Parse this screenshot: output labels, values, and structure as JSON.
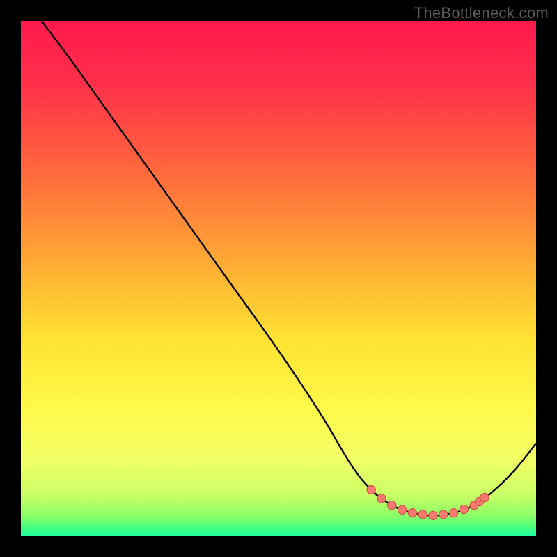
{
  "watermark": "TheBottleneck.com",
  "chart_data": {
    "type": "line",
    "title": "",
    "xlabel": "",
    "ylabel": "",
    "xlim": [
      0,
      100
    ],
    "ylim": [
      0,
      100
    ],
    "grid": false,
    "curve": [
      {
        "x": 4,
        "y": 100
      },
      {
        "x": 10,
        "y": 92
      },
      {
        "x": 20,
        "y": 78
      },
      {
        "x": 30,
        "y": 64
      },
      {
        "x": 40,
        "y": 50
      },
      {
        "x": 50,
        "y": 36
      },
      {
        "x": 58,
        "y": 24
      },
      {
        "x": 64,
        "y": 14
      },
      {
        "x": 68,
        "y": 9
      },
      {
        "x": 72,
        "y": 6
      },
      {
        "x": 76,
        "y": 4.5
      },
      {
        "x": 80,
        "y": 4
      },
      {
        "x": 84,
        "y": 4.5
      },
      {
        "x": 88,
        "y": 6
      },
      {
        "x": 92,
        "y": 9
      },
      {
        "x": 96,
        "y": 13
      },
      {
        "x": 100,
        "y": 18
      }
    ],
    "optimum_points": [
      {
        "x": 68,
        "y": 9
      },
      {
        "x": 70,
        "y": 7.3
      },
      {
        "x": 72,
        "y": 6
      },
      {
        "x": 74,
        "y": 5.1
      },
      {
        "x": 76,
        "y": 4.5
      },
      {
        "x": 78,
        "y": 4.2
      },
      {
        "x": 80,
        "y": 4
      },
      {
        "x": 82,
        "y": 4.2
      },
      {
        "x": 84,
        "y": 4.5
      },
      {
        "x": 86,
        "y": 5.2
      },
      {
        "x": 88,
        "y": 6
      },
      {
        "x": 89,
        "y": 6.7
      },
      {
        "x": 90,
        "y": 7.5
      }
    ],
    "gradient_stops": [
      {
        "offset": 0.0,
        "color": "#ff1a4d"
      },
      {
        "offset": 0.12,
        "color": "#ff2f4a"
      },
      {
        "offset": 0.25,
        "color": "#ff5a3f"
      },
      {
        "offset": 0.38,
        "color": "#ff8838"
      },
      {
        "offset": 0.5,
        "color": "#ffb733"
      },
      {
        "offset": 0.62,
        "color": "#ffe333"
      },
      {
        "offset": 0.75,
        "color": "#fff94a"
      },
      {
        "offset": 0.85,
        "color": "#f3ff66"
      },
      {
        "offset": 0.92,
        "color": "#c9ff66"
      },
      {
        "offset": 0.96,
        "color": "#8dff66"
      },
      {
        "offset": 0.985,
        "color": "#3fff80"
      },
      {
        "offset": 1.0,
        "color": "#1fffa3"
      }
    ],
    "point_fill": "#fb7a6f",
    "point_stroke": "#c94b42",
    "curve_stroke": "#000000"
  }
}
